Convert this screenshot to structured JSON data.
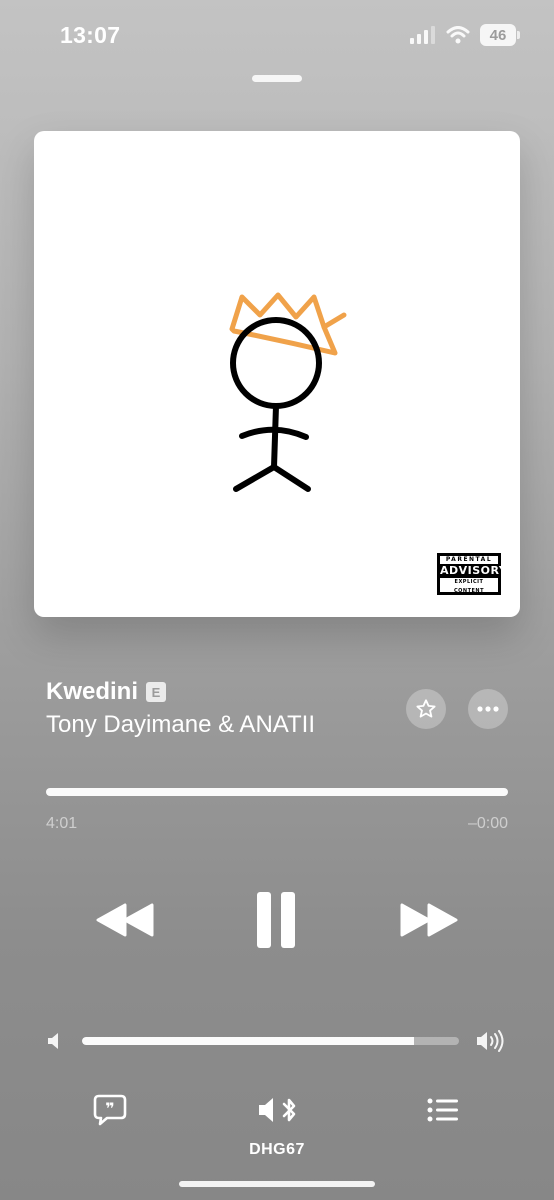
{
  "status_bar": {
    "time": "13:07",
    "battery": "46"
  },
  "artwork": {
    "advisory_top": "PARENTAL",
    "advisory_main": "ADVISORY",
    "advisory_bottom": "EXPLICIT CONTENT"
  },
  "track": {
    "title": "Kwedini",
    "explicit_badge": "E",
    "artist": "Tony Dayimane & ANATII"
  },
  "progress": {
    "elapsed": "4:01",
    "remaining": "–0:00",
    "fraction": 1.0
  },
  "volume": {
    "level": 0.88
  },
  "output_device": {
    "name": "DHG67"
  },
  "icons": [
    "signal-icon",
    "wifi-icon",
    "battery-icon",
    "star-icon",
    "more-icon",
    "rewind-icon",
    "pause-icon",
    "fast-forward-icon",
    "volume-low-icon",
    "volume-high-icon",
    "lyrics-icon",
    "airplay-bluetooth-icon",
    "queue-icon"
  ]
}
